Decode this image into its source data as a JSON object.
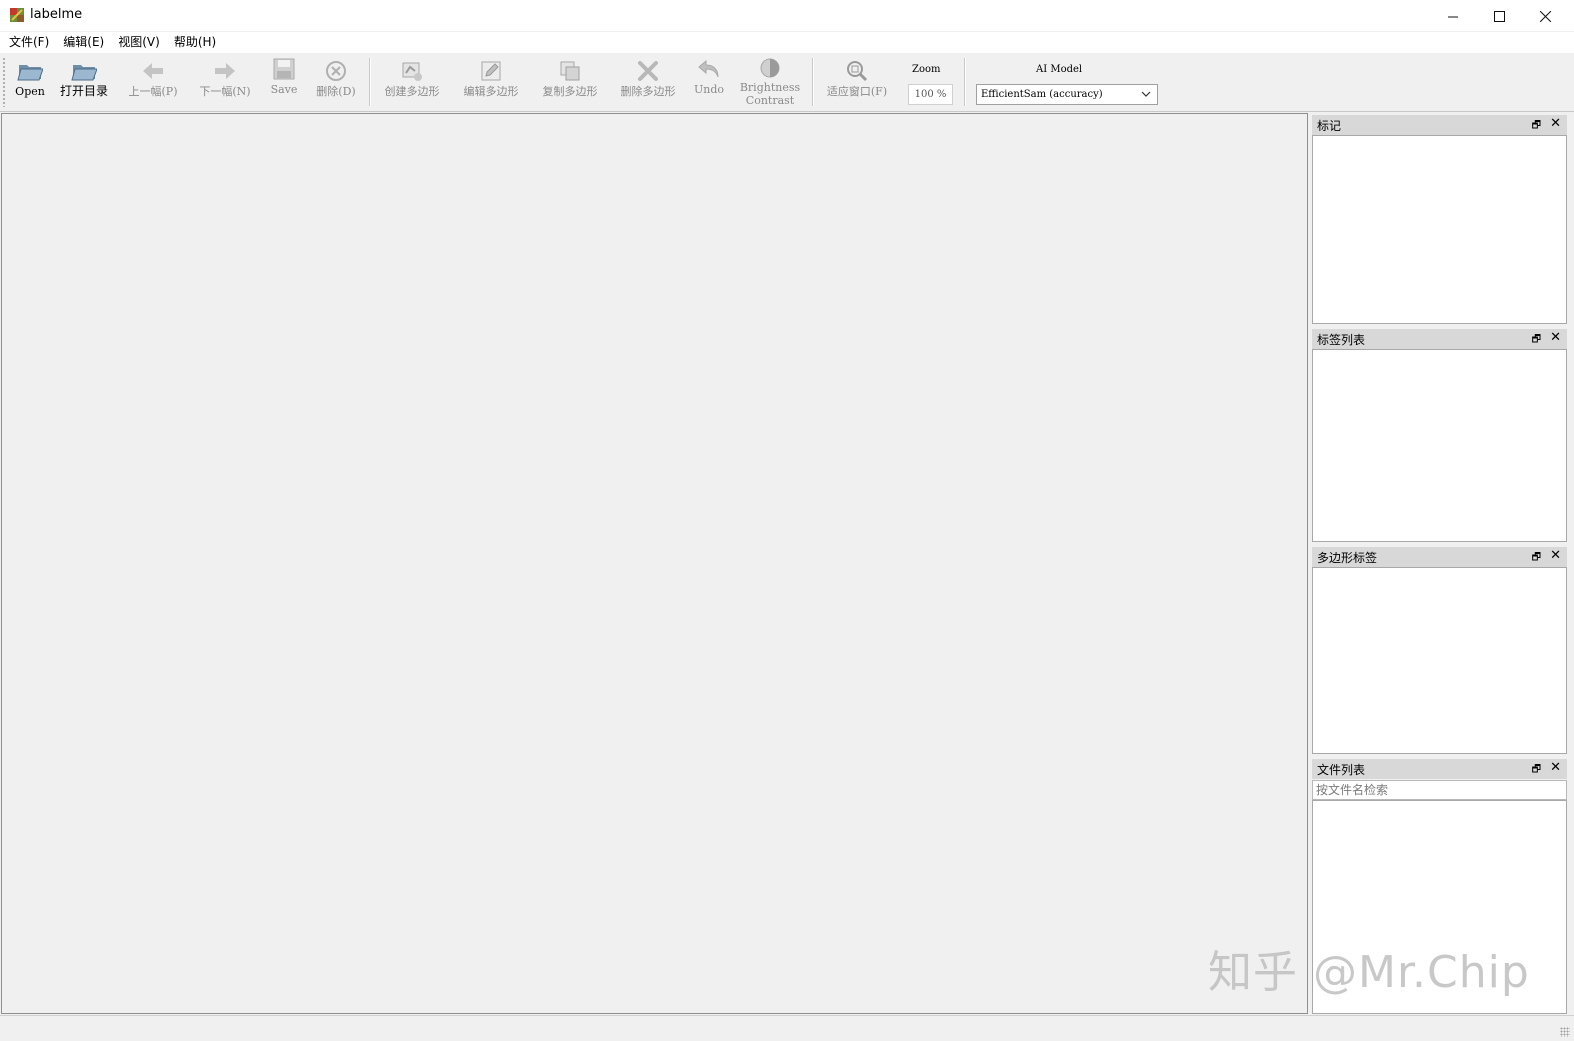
{
  "window": {
    "title": "labelme"
  },
  "menu": [
    "文件(F)",
    "编辑(E)",
    "视图(V)",
    "帮助(H)"
  ],
  "toolbar": {
    "open": "Open",
    "open_dir": "打开目录",
    "prev": "上一幅(P)",
    "next": "下一幅(N)",
    "save": "Save",
    "delete_file": "删除(D)",
    "create_polygon": "创建多边形",
    "edit_polygon": "编辑多边形",
    "copy_polygon": "复制多边形",
    "delete_polygon": "删除多边形",
    "undo": "Undo",
    "brightness_line1": "Brightness",
    "brightness_line2": "Contrast",
    "fit_window": "适应窗口(F)",
    "zoom_label": "Zoom",
    "zoom_value": "100 %",
    "ai_label": "AI Model",
    "ai_model_selected": "EfficientSam (accuracy)"
  },
  "docks": {
    "flags": "标记",
    "label_list": "标签列表",
    "polygon_labels": "多边形标签",
    "file_list": "文件列表",
    "file_search_placeholder": "按文件名检索"
  },
  "watermark": "知乎 @Mr.Chip"
}
